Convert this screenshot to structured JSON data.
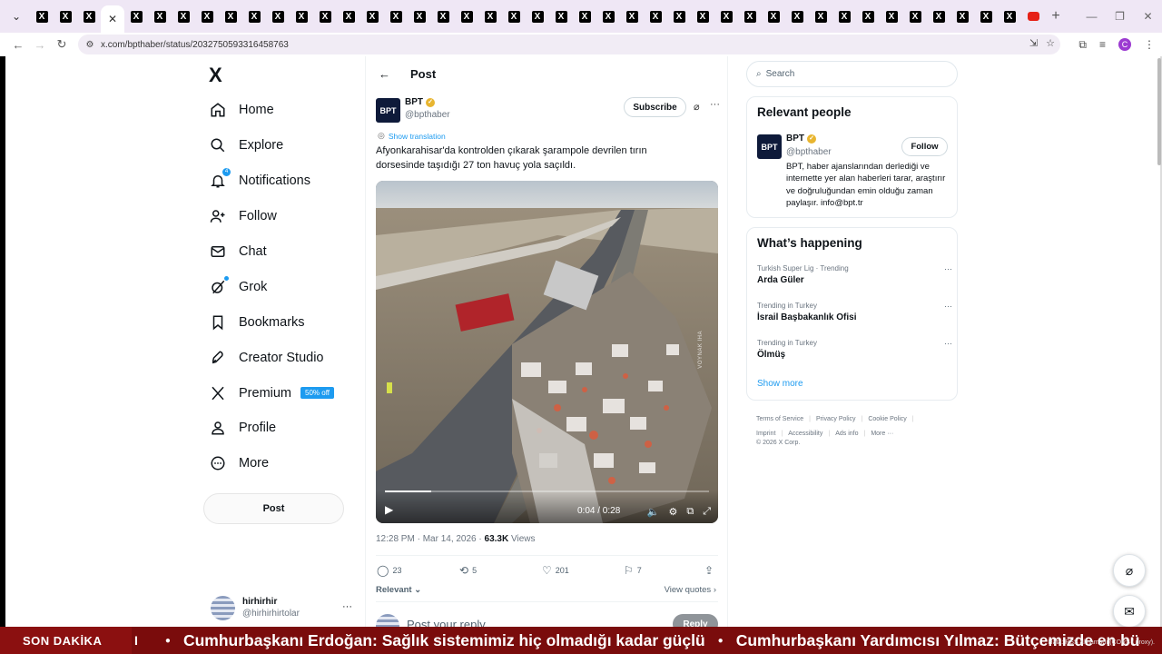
{
  "browser": {
    "url": "x.com/bpthaber/status/2032750593316458763",
    "tab_count_x": 42,
    "profile_initial": "C"
  },
  "nav": {
    "logo": "X",
    "items": [
      {
        "label": "Home",
        "icon": "home-icon"
      },
      {
        "label": "Explore",
        "icon": "search-icon"
      },
      {
        "label": "Notifications",
        "icon": "bell-icon",
        "badge": "4"
      },
      {
        "label": "Follow",
        "icon": "person-plus-icon"
      },
      {
        "label": "Chat",
        "icon": "mail-icon"
      },
      {
        "label": "Grok",
        "icon": "grok-icon"
      },
      {
        "label": "Bookmarks",
        "icon": "bookmark-icon"
      },
      {
        "label": "Creator Studio",
        "icon": "rocket-icon"
      },
      {
        "label": "Premium",
        "icon": "x-icon",
        "tag": "50% off"
      },
      {
        "label": "Profile",
        "icon": "profile-icon"
      },
      {
        "label": "More",
        "icon": "more-circle-icon"
      }
    ],
    "post_button": "Post",
    "account": {
      "name": "hirhirhir",
      "handle": "@hirhirhirtolar"
    }
  },
  "main": {
    "title": "Post",
    "author": {
      "name": "BPT",
      "handle": "@bpthaber",
      "logo_text": "BPT"
    },
    "subscribe": "Subscribe",
    "show_translation": "Show translation",
    "text": "Afyonkarahisar'da kontrolden çıkarak şarampole devrilen tırın dorsesinde taşıdığı 27 ton havuç yola saçıldı.",
    "video": {
      "time": "0:04 / 0:28",
      "progress": 0.143,
      "watermark": "VOYNAK İHA"
    },
    "meta": {
      "datetime": "12:28 PM · Mar 14, 2026 · ",
      "views": "63.3K",
      "views_label": " Views"
    },
    "actions": {
      "replies": "23",
      "reposts": "5",
      "likes": "201",
      "bookmarks": "7"
    },
    "relevant": "Relevant",
    "view_quotes": "View quotes",
    "reply_placeholder": "Post your reply",
    "reply_button": "Reply"
  },
  "right": {
    "search_placeholder": "Search",
    "relevant_people": {
      "title": "Relevant people",
      "name": "BPT",
      "handle": "@bpthaber",
      "logo_text": "BPT",
      "follow": "Follow",
      "bio": "BPT, haber ajanslarından derlediği ve internette yer alan haberleri tarar, araştırır ve doğruluğundan emin olduğu zaman paylaşır. info@bpt.tr"
    },
    "happening": {
      "title": "What’s happening",
      "trends": [
        {
          "meta": "Turkish Super Lig · Trending",
          "name": "Arda Güler"
        },
        {
          "meta": "Trending in Turkey",
          "name": "İsrail Başbakanlık Ofisi"
        },
        {
          "meta": "Trending in Turkey",
          "name": "Ölmüş"
        }
      ],
      "show_more": "Show more"
    },
    "footer": {
      "links": [
        "Terms of Service",
        "Privacy Policy",
        "Cookie Policy",
        "Imprint",
        "Accessibility",
        "Ads info",
        "More ···"
      ],
      "copyright": "© 2026 X Corp."
    }
  },
  "ticker": {
    "label": "SON DAKİKA",
    "items": [
      "Cumhurbaşkanı Erdoğan: Sağlık sistemimiz hiç olmadığı kadar güçlü",
      "Cumhurbaşkanı Yardımcısı Yılmaz: Bütçemizde en bü"
    ],
    "error": "Hata: RSS alınamadı (CORS / proxy)."
  }
}
